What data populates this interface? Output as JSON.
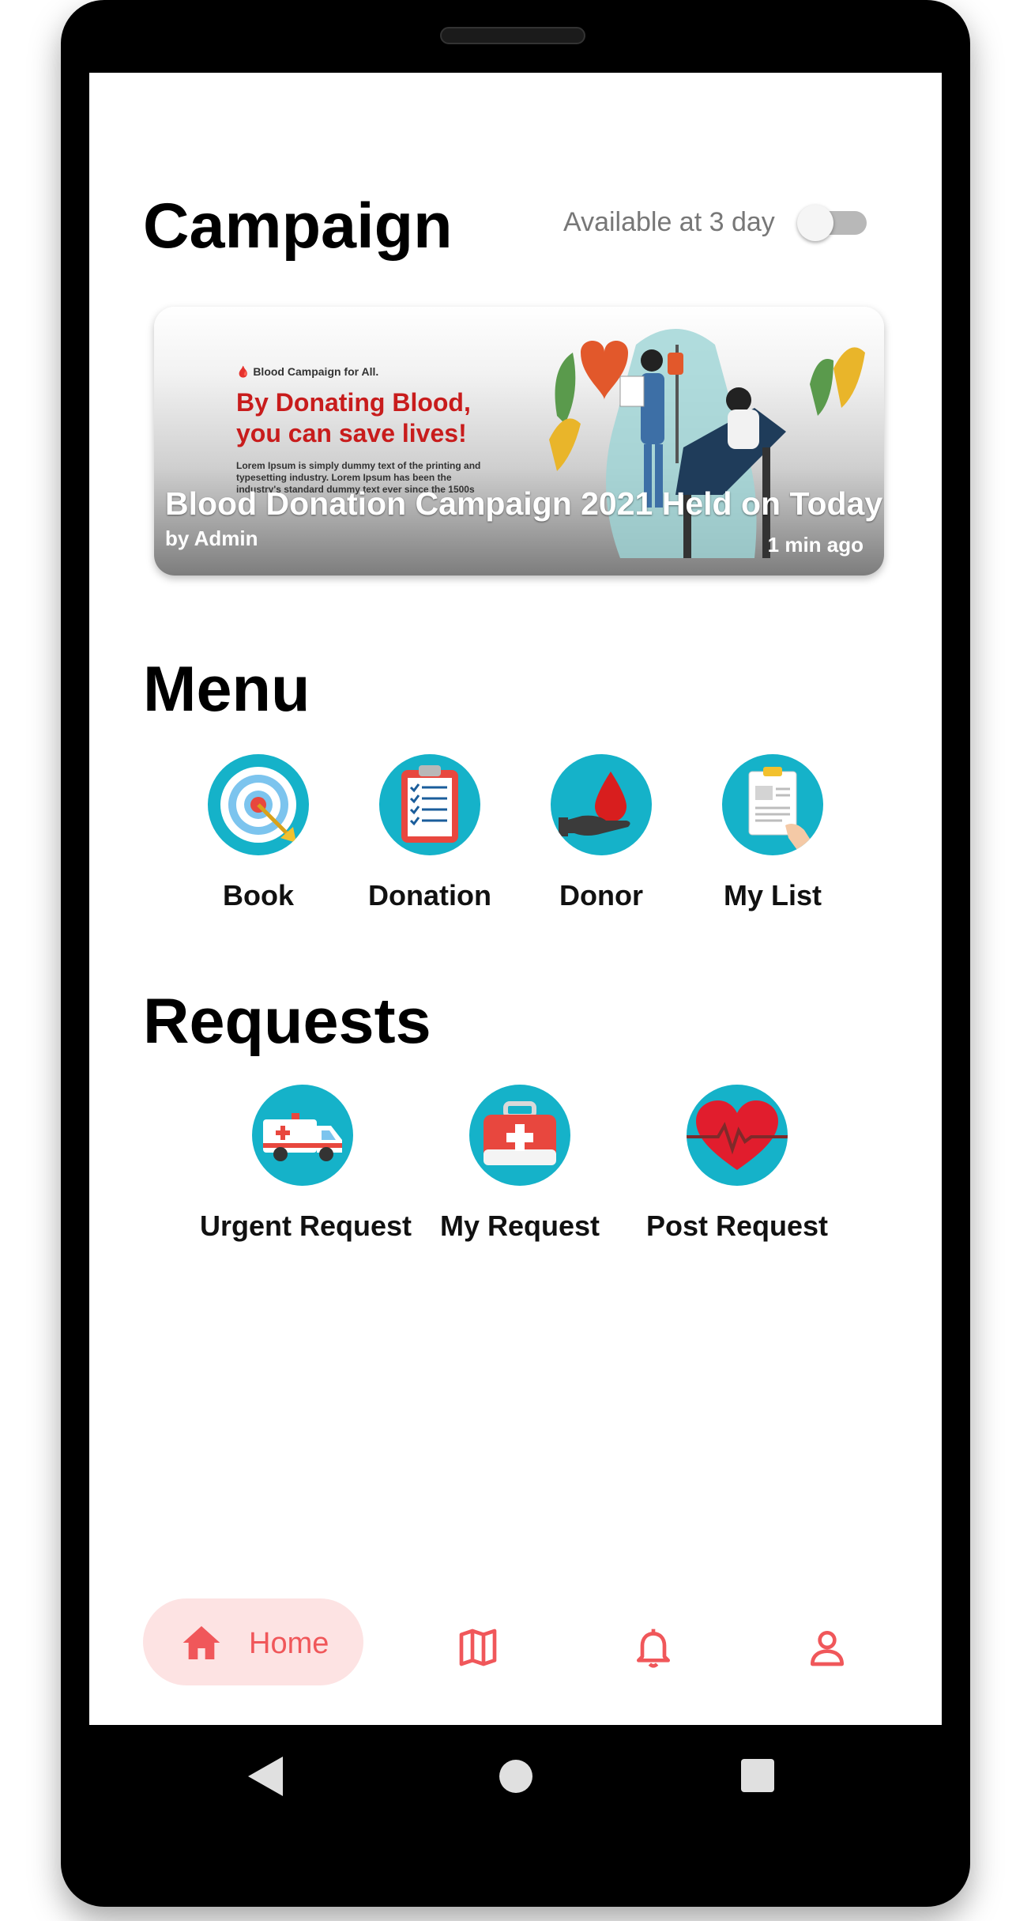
{
  "campaign": {
    "title": "Campaign",
    "availability_text": "Available at 3 day",
    "toggle_on": false,
    "card": {
      "poster_kicker": "🩸 Blood Campaign for All.",
      "poster_heading": "By Donating Blood, you can save lives!",
      "poster_body": "Lorem Ipsum is simply dummy text of the printing and typesetting industry. Lorem Ipsum has been the industry's standard dummy text ever since the 1500s",
      "title": "Blood Donation Campaign 2021 Held on Today",
      "author": "by Admin",
      "time": "1 min ago"
    }
  },
  "menu": {
    "title": "Menu",
    "items": [
      {
        "label": "Book",
        "icon": "target-icon"
      },
      {
        "label": "Donation",
        "icon": "clipboard-checklist-icon"
      },
      {
        "label": "Donor",
        "icon": "blood-drop-hand-icon"
      },
      {
        "label": "My List",
        "icon": "clipboard-hand-icon"
      }
    ]
  },
  "requests": {
    "title": "Requests",
    "items": [
      {
        "label": "Urgent Request",
        "icon": "ambulance-icon"
      },
      {
        "label": "My Request",
        "icon": "first-aid-kit-icon"
      },
      {
        "label": "Post Request",
        "icon": "heartbeat-icon"
      }
    ]
  },
  "bottom_nav": {
    "home_label": "Home",
    "items": [
      "home-icon",
      "map-icon",
      "bell-icon",
      "profile-icon"
    ],
    "active": "home"
  },
  "colors": {
    "accent": "#f0575a",
    "accent_light": "#fde3e3",
    "icon_bg": "#15b2c9"
  }
}
